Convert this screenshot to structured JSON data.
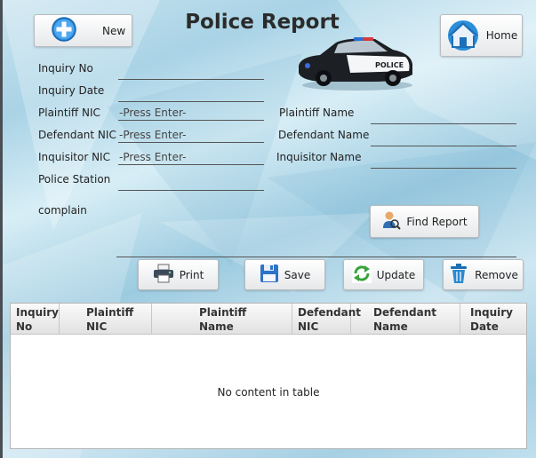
{
  "header": {
    "title": "Police Report",
    "new_label": "New",
    "home_label": "Home"
  },
  "form": {
    "inquiry_no_label": "Inquiry No",
    "inquiry_date_label": "Inquiry Date",
    "plaintiff_nic_label": "Plaintiff NIC",
    "plaintiff_nic_placeholder": "-Press Enter-",
    "defendant_nic_label": "Defendant NIC",
    "defendant_nic_placeholder": "-Press Enter-",
    "inquisitor_nic_label": "Inquisitor NIC",
    "inquisitor_nic_placeholder": "-Press Enter-",
    "police_station_label": "Police Station",
    "complain_label": "complain",
    "plaintiff_name_label": "Plaintiff Name",
    "defendant_name_label": "Defendant Name",
    "inquisitor_name_label": "Inquisitor Name",
    "find_report_label": "Find Report"
  },
  "actions": {
    "print_label": "Print",
    "save_label": "Save",
    "update_label": "Update",
    "remove_label": "Remove"
  },
  "table": {
    "columns": [
      [
        "Inquiry",
        "No"
      ],
      [
        "Plaintiff",
        "NIC"
      ],
      [
        "Plaintiff",
        "Name"
      ],
      [
        "Defendant",
        "NIC"
      ],
      [
        "Defendant",
        "Name"
      ],
      [
        "Inquiry",
        "Date"
      ]
    ],
    "empty_message": "No content in table"
  },
  "car": {
    "door_text": "POLICE"
  },
  "colors": {
    "accent_blue": "#1f8fd6",
    "field_line": "#555555"
  }
}
